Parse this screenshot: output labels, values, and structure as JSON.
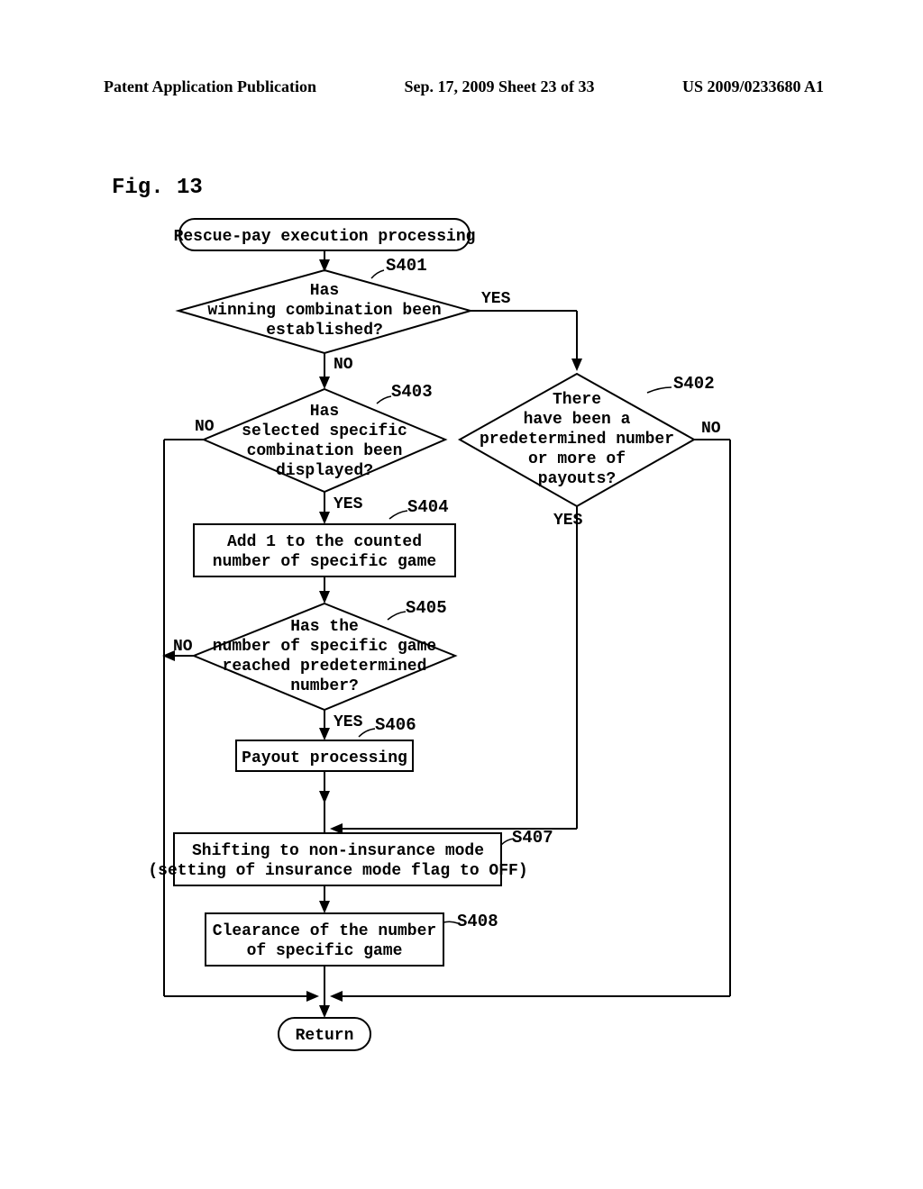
{
  "header": {
    "left": "Patent Application Publication",
    "center": "Sep. 17, 2009  Sheet 23 of 33",
    "right": "US 2009/0233680 A1"
  },
  "figure": {
    "label": "Fig. 13",
    "start": "Rescue-pay execution processing",
    "end": "Return",
    "steps": {
      "s401": {
        "id": "S401",
        "l1": "Has",
        "l2": "winning combination been",
        "l3": "established?",
        "yes": "YES",
        "no": "NO"
      },
      "s402": {
        "id": "S402",
        "l1": "There",
        "l2": "have been a",
        "l3": "predetermined number",
        "l4": "or more of",
        "l5": "payouts?",
        "yes": "YES",
        "no": "NO"
      },
      "s403": {
        "id": "S403",
        "l1": "Has",
        "l2": "selected specific",
        "l3": "combination been",
        "l4": "displayed?",
        "yes": "YES",
        "no": "NO"
      },
      "s404": {
        "id": "S404",
        "l1": "Add 1 to the counted",
        "l2": "number of specific game"
      },
      "s405": {
        "id": "S405",
        "l1": "Has the",
        "l2": "number of specific game",
        "l3": "reached predetermined",
        "l4": "number?",
        "yes": "YES",
        "no": "NO"
      },
      "s406": {
        "id": "S406",
        "l1": "Payout processing"
      },
      "s407": {
        "id": "S407",
        "l1": "Shifting to non-insurance mode",
        "l2": "(setting of insurance mode flag to OFF)"
      },
      "s408": {
        "id": "S408",
        "l1": "Clearance of the number",
        "l2": "of specific game"
      }
    }
  }
}
